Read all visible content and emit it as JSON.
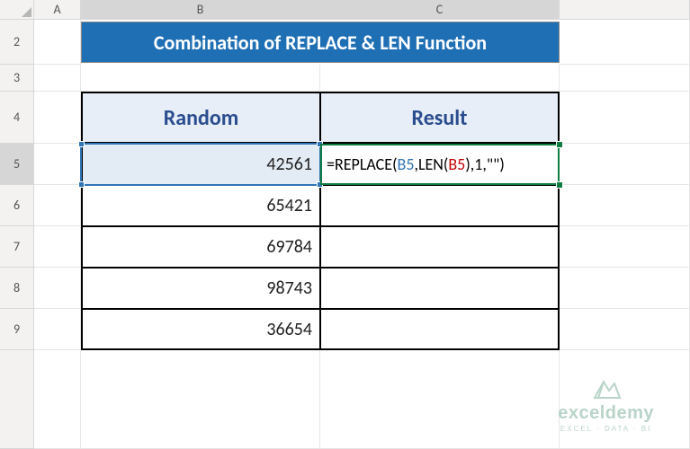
{
  "columns": [
    "A",
    "B",
    "C"
  ],
  "rows": [
    "2",
    "3",
    "4",
    "5",
    "6",
    "7",
    "8",
    "9"
  ],
  "title": "Combination of REPLACE & LEN Function",
  "headers": {
    "b4": "Random",
    "c4": "Result"
  },
  "data": {
    "b5": "42561",
    "b6": "65421",
    "b7": "69784",
    "b8": "98743",
    "b9": "36654"
  },
  "formula": {
    "prefix": "=REPLACE(",
    "ref1a": "B5",
    "mid1": ",LEN(",
    "ref1b": "B5",
    "mid2": "),",
    "num": "1",
    "mid3": ",\"\")"
  },
  "watermark": {
    "brand": "exceldemy",
    "tag": "EXCEL · DATA · BI"
  },
  "chart_data": {
    "type": "table",
    "title": "Combination of REPLACE & LEN Function",
    "columns": [
      "Random",
      "Result"
    ],
    "rows": [
      {
        "Random": 42561,
        "Result": "=REPLACE(B5,LEN(B5),1,\"\")"
      },
      {
        "Random": 65421,
        "Result": ""
      },
      {
        "Random": 69784,
        "Result": ""
      },
      {
        "Random": 98743,
        "Result": ""
      },
      {
        "Random": 36654,
        "Result": ""
      }
    ]
  }
}
